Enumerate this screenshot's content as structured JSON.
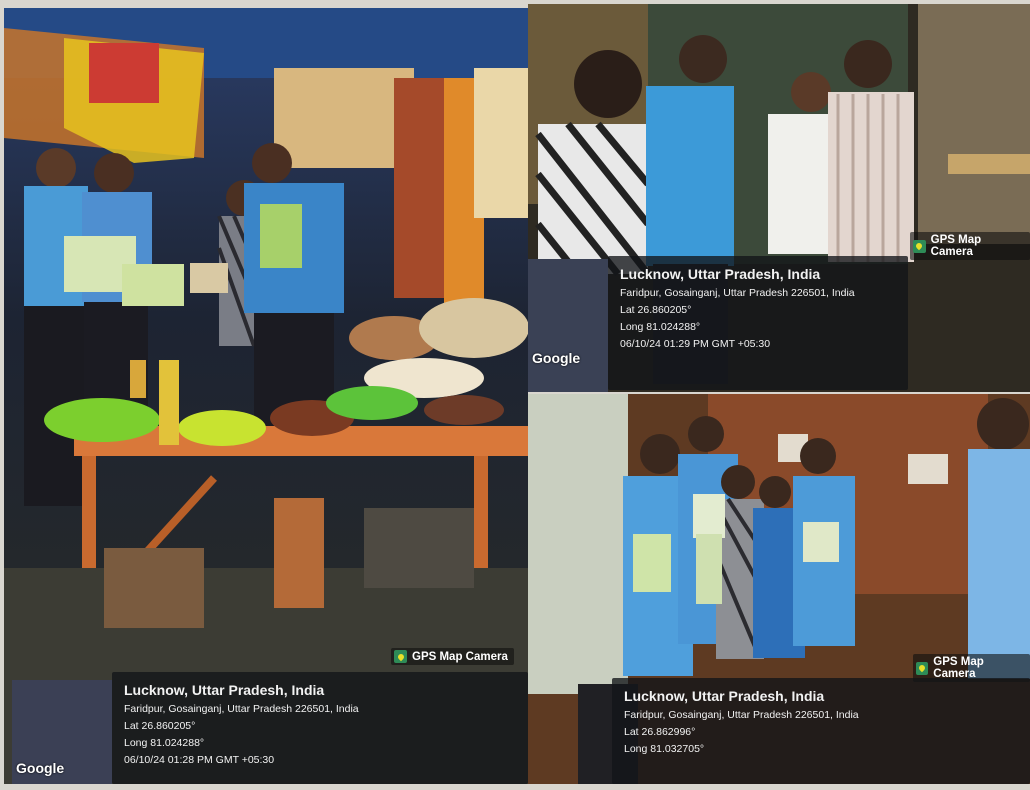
{
  "watermark": {
    "label": "GPS Map Camera",
    "brand": "Google"
  },
  "photos": [
    {
      "name": "stall-photo",
      "place": "Lucknow, Uttar Pradesh, India",
      "address": "Faridpur, Gosainganj, Uttar Pradesh 226501, India",
      "lat": "Lat 26.860205°",
      "long": "Long 81.024288°",
      "timestamp": "06/10/24 01:28 PM GMT +05:30"
    },
    {
      "name": "conversation-photo",
      "place": "Lucknow, Uttar Pradesh, India",
      "address": "Faridpur, Gosainganj, Uttar Pradesh 226501, India",
      "lat": "Lat 26.860205°",
      "long": "Long 81.024288°",
      "timestamp": "06/10/24 01:29 PM GMT +05:30"
    },
    {
      "name": "students-photo",
      "place": "Lucknow, Uttar Pradesh, India",
      "address": "Faridpur, Gosainganj, Uttar Pradesh 226501, India",
      "lat": "Lat 26.862996°",
      "long": "Long 81.032705°"
    }
  ],
  "colors": {
    "shirt_blue": "#4a9bd6",
    "table_orange": "#d9783a",
    "bowl_green": "#7ccf2e",
    "overlay_dark": "#141618"
  }
}
